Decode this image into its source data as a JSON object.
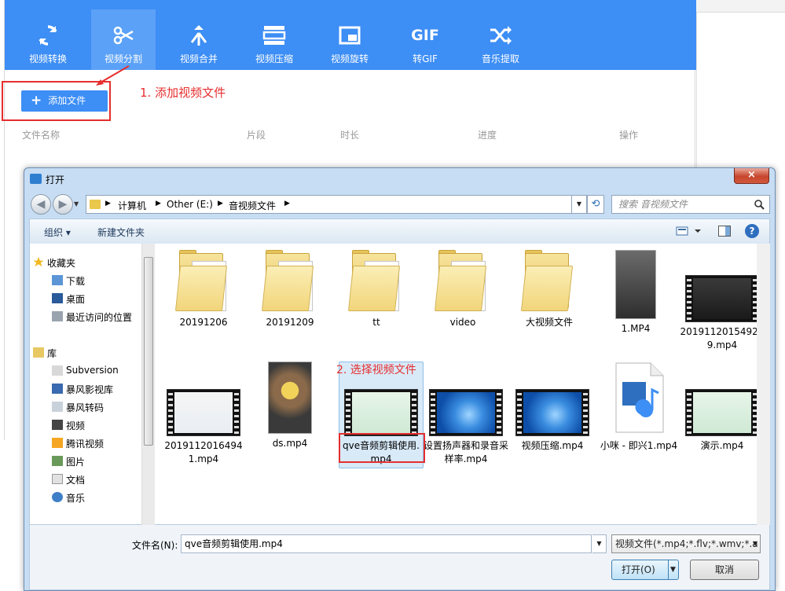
{
  "app": {
    "toolbar": [
      {
        "label": "视频转换",
        "icon": "refresh-icon"
      },
      {
        "label": "视频分割",
        "icon": "scissors-icon"
      },
      {
        "label": "视频合并",
        "icon": "merge-icon"
      },
      {
        "label": "视频压缩",
        "icon": "compress-icon"
      },
      {
        "label": "视频旋转",
        "icon": "rotate-icon"
      },
      {
        "label": "转GIF",
        "icon": "gif-icon",
        "icon_text": "GIF"
      },
      {
        "label": "音乐提取",
        "icon": "shuffle-icon"
      }
    ],
    "active_tool": "视频分割",
    "add_file_label": "添加文件",
    "columns": [
      "文件名称",
      "片段",
      "时长",
      "进度",
      "操作"
    ],
    "annotation_1": "1. 添加视频文件",
    "accent": "#3d8ef5",
    "annotation_color": "#e62e2e"
  },
  "dialog": {
    "title": "打开",
    "close_glyph": "×",
    "breadcrumbs": [
      "计算机",
      "Other (E:)",
      "音视频文件"
    ],
    "search_placeholder": "搜索 音视频文件",
    "commands": {
      "organize": "组织",
      "new_folder": "新建文件夹"
    },
    "nav": {
      "favorites": {
        "label": "收藏夹",
        "items": [
          "下载",
          "桌面",
          "最近访问的位置"
        ]
      },
      "libraries": {
        "label": "库",
        "items": [
          "Subversion",
          "暴风影视库",
          "暴风转码",
          "视频",
          "腾讯视频",
          "图片",
          "文档",
          "音乐"
        ]
      }
    },
    "files_row1": [
      "20191206",
      "20191209",
      "tt",
      "video",
      "大视频文件",
      "1.MP4",
      "201911201549299.mp4"
    ],
    "files_row2": [
      "20191120164941.mp4",
      "ds.mp4",
      "qve音频剪辑使用.mp4",
      "设置扬声器和录音采样率.mp4",
      "视频压缩.mp4",
      "小咪 - 即兴1.mp4",
      "演示.mp4"
    ],
    "selected_file": "qve音频剪辑使用.mp4",
    "annotation_2": "2. 选择视频文件",
    "filename_label": "文件名(N):",
    "filename_value": "qve音频剪辑使用.mp4",
    "filter_value": "视频文件(*.mp4;*.flv;*.wmv;*.a",
    "open_label": "打开(O)",
    "cancel_label": "取消"
  }
}
